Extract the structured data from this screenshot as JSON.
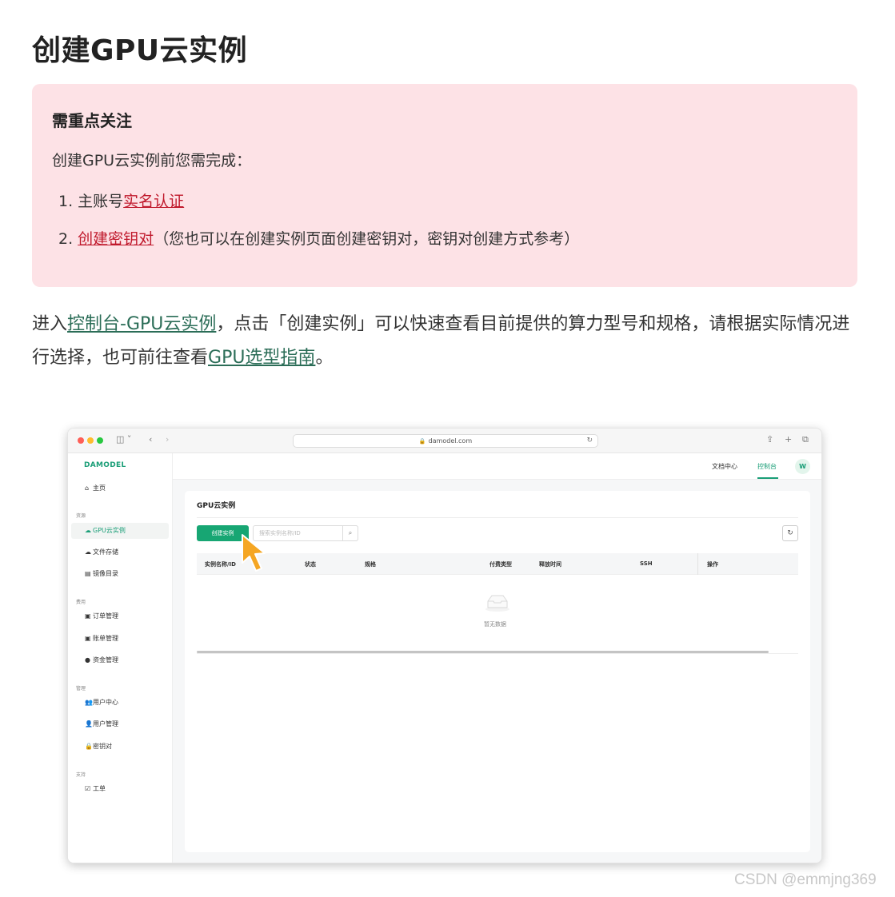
{
  "doc": {
    "title": "创建GPU云实例",
    "notice": {
      "title": "需重点关注",
      "intro": "创建GPU云实例前您需完成：",
      "item1_prefix": "1. 主账号",
      "item1_link": "实名认证",
      "item2_prefix": "2. ",
      "item2_link": "创建密钥对",
      "item2_suffix": "（您也可以在创建实例页面创建密钥对，密钥对创建方式参考）"
    },
    "paragraph": {
      "p1": "进入",
      "link1": "控制台-GPU云实例",
      "p2": "，点击「创建实例」可以快速查看目前提供的算力型号和规格，请根据实际情况进行选择，也可前往查看",
      "link2": "GPU选型指南",
      "p3": "。"
    }
  },
  "screenshot": {
    "browser": {
      "url": "damodel.com",
      "lock_icon": "🔒",
      "reload_icon": "↻"
    },
    "logo": "DAMODEL",
    "sidebar": {
      "home": "主页",
      "group_resources": "资源",
      "gpu_instance": "GPU云实例",
      "file_storage": "文件存储",
      "image_catalog": "镜像目录",
      "group_billing": "费用",
      "order_mgmt": "订单管理",
      "bill_mgmt": "账单管理",
      "fund_mgmt": "资金管理",
      "group_manage": "管理",
      "user_center": "用户中心",
      "user_mgmt": "用户管理",
      "key_pair": "密钥对",
      "group_support": "支持",
      "ticket": "工单"
    },
    "topnav": {
      "docs": "文档中心",
      "console": "控制台",
      "avatar": "W"
    },
    "panel": {
      "title": "GPU云实例",
      "create_button": "创建实例",
      "search_placeholder": "搜索实例名称/ID",
      "columns": [
        "实例名称/ID",
        "状态",
        "规格",
        "付费类型",
        "释放时间",
        "SSH",
        "操作"
      ],
      "empty_text": "暂无数据"
    }
  },
  "watermark": "CSDN @emmjng369",
  "colors": {
    "brand_green": "#1a9e77",
    "button_green": "#17a673",
    "notice_bg": "#fde2e6",
    "red_link": "#c0192c",
    "green_link": "#2b6d57"
  }
}
